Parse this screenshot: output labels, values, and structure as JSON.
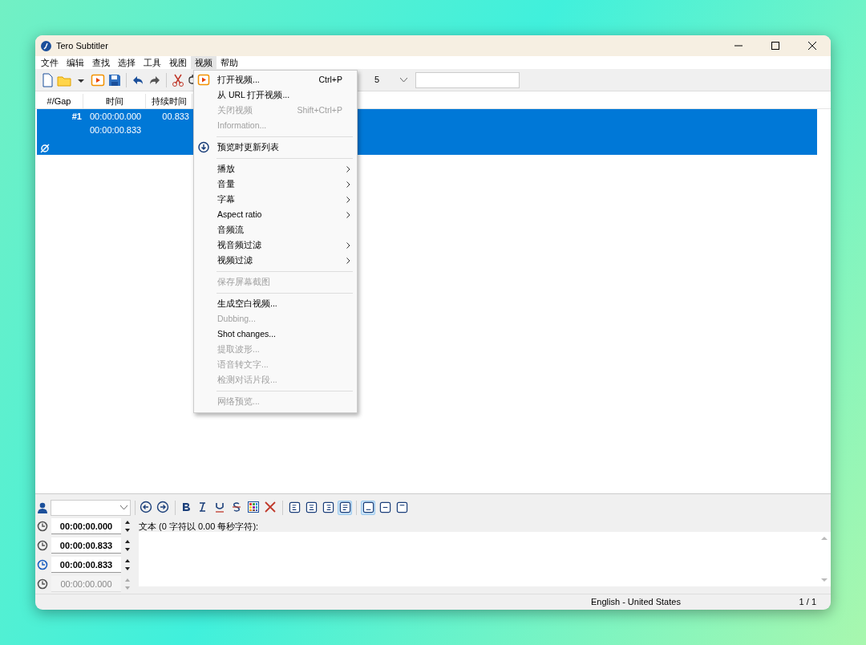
{
  "window": {
    "title": "Tero Subtitler"
  },
  "menu_bar": [
    {
      "label": "文件",
      "selected": false
    },
    {
      "label": "编辑",
      "selected": false
    },
    {
      "label": "查找",
      "selected": false
    },
    {
      "label": "选择",
      "selected": false
    },
    {
      "label": "工具",
      "selected": false
    },
    {
      "label": "视图",
      "selected": false
    },
    {
      "label": "视频",
      "selected": true
    },
    {
      "label": "帮助",
      "selected": false
    }
  ],
  "toolbar": {
    "combo_value": "5"
  },
  "table": {
    "columns": [
      "#/Gap",
      "时间",
      "持续时间"
    ],
    "rows": [
      {
        "number": "#1",
        "start": "00:00:00.000",
        "end": "00:00:00.833",
        "duration": "00.833",
        "selected": true
      }
    ]
  },
  "video_menu": {
    "items": [
      {
        "kind": "item",
        "label": "打开视频...",
        "shortcut": "Ctrl+P",
        "disabled": false,
        "submenu": false
      },
      {
        "kind": "item",
        "label": "从 URL 打开视频...",
        "disabled": false,
        "submenu": false
      },
      {
        "kind": "item",
        "label": "关闭视频",
        "shortcut": "Shift+Ctrl+P",
        "disabled": true,
        "submenu": false
      },
      {
        "kind": "item",
        "label": "Information...",
        "disabled": true,
        "submenu": false
      },
      {
        "kind": "separator"
      },
      {
        "kind": "item",
        "label": "预览时更新列表",
        "disabled": false,
        "submenu": false
      },
      {
        "kind": "separator"
      },
      {
        "kind": "item",
        "label": "播放",
        "disabled": false,
        "submenu": true
      },
      {
        "kind": "item",
        "label": "音量",
        "disabled": false,
        "submenu": true
      },
      {
        "kind": "item",
        "label": "字幕",
        "disabled": false,
        "submenu": true
      },
      {
        "kind": "item",
        "label": "Aspect ratio",
        "disabled": false,
        "submenu": true
      },
      {
        "kind": "item",
        "label": "音频流",
        "disabled": false,
        "submenu": false
      },
      {
        "kind": "item",
        "label": "视音频过滤",
        "disabled": false,
        "submenu": true
      },
      {
        "kind": "item",
        "label": "视频过滤",
        "disabled": false,
        "submenu": true
      },
      {
        "kind": "separator"
      },
      {
        "kind": "item",
        "label": "保存屏幕截图",
        "disabled": true,
        "submenu": false
      },
      {
        "kind": "separator"
      },
      {
        "kind": "item",
        "label": "生成空白视频...",
        "disabled": false,
        "submenu": false
      },
      {
        "kind": "item",
        "label": "Dubbing...",
        "disabled": true,
        "submenu": false
      },
      {
        "kind": "item",
        "label": "Shot changes...",
        "disabled": false,
        "submenu": false
      },
      {
        "kind": "item",
        "label": "提取波形...",
        "disabled": true,
        "submenu": false
      },
      {
        "kind": "item",
        "label": "语音转文字...",
        "disabled": true,
        "submenu": false
      },
      {
        "kind": "item",
        "label": "检测对话片段...",
        "disabled": true,
        "submenu": false
      },
      {
        "kind": "separator"
      },
      {
        "kind": "item",
        "label": "网络预览...",
        "disabled": true,
        "submenu": false
      }
    ]
  },
  "editor": {
    "align_buttons": [
      {
        "selected": false
      },
      {
        "selected": false
      },
      {
        "selected": false
      },
      {
        "selected": true
      },
      {
        "selected": true
      },
      {
        "selected": false
      },
      {
        "selected": false
      }
    ],
    "times": [
      {
        "value": "00:00:00.000",
        "disabled": false
      },
      {
        "value": "00:00:00.833",
        "disabled": false
      },
      {
        "value": "00:00:00.833",
        "disabled": false
      },
      {
        "value": "00:00:00.000",
        "disabled": true
      }
    ],
    "text_label": "文本 (0 字符以 0.00 每秒字符):"
  },
  "status_bar": {
    "language": "English - United States",
    "position": "1 / 1"
  }
}
